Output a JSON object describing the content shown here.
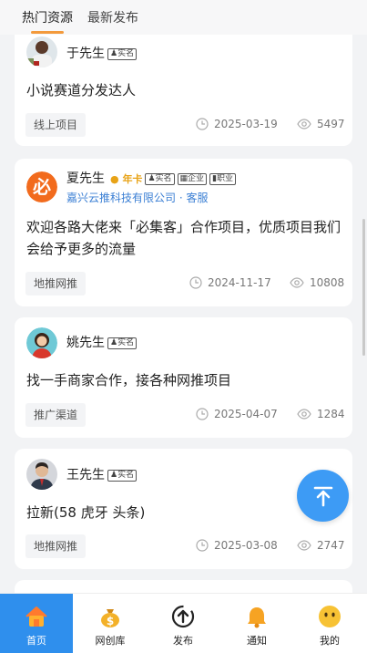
{
  "tabs": [
    {
      "label": "热门资源"
    },
    {
      "label": "最新发布"
    }
  ],
  "badges": {
    "realname": "实名",
    "enterprise": "企业",
    "job": "职业",
    "annual": "年卡"
  },
  "posts": [
    {
      "name": "于先生",
      "content": "小说赛道分发达人",
      "tag": "线上项目",
      "date": "2025-03-19",
      "views": "5497"
    },
    {
      "name": "夏先生",
      "company": "嘉兴云推科技有限公司 · 客服",
      "content": "欢迎各路大佬来「必集客」合作项目，优质项目我们会给予更多的流量",
      "tag": "地推网推",
      "date": "2024-11-17",
      "views": "10808"
    },
    {
      "name": "姚先生",
      "content": "找一手商家合作，接各种网推项目",
      "tag": "推广渠道",
      "date": "2025-04-07",
      "views": "1284"
    },
    {
      "name": "王先生",
      "content": "拉新(58 虎牙 头条)",
      "tag": "地推网推",
      "date": "2025-03-08",
      "views": "2747"
    }
  ],
  "nav": [
    {
      "label": "首页",
      "icon": "home-icon"
    },
    {
      "label": "网创库",
      "icon": "money-bag-icon"
    },
    {
      "label": "发布",
      "icon": "publish-icon"
    },
    {
      "label": "通知",
      "icon": "bell-icon"
    },
    {
      "label": "我的",
      "icon": "smiley-face-icon"
    }
  ],
  "colors": {
    "accent": "#2f8fed",
    "fab": "#3d9bf5",
    "tab_underline": "#f39a3c",
    "company_link": "#3b7fd4",
    "annual_badge": "#e8a317"
  }
}
